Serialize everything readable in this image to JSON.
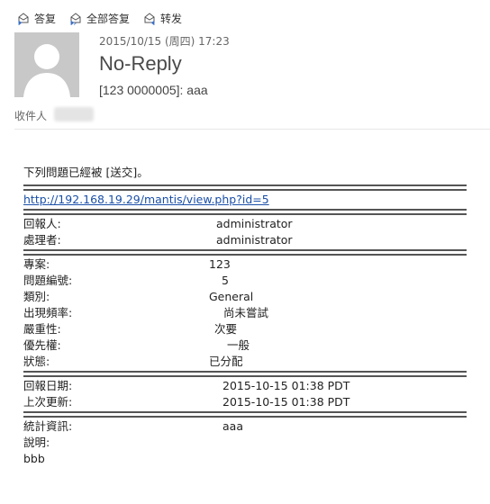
{
  "toolbar": {
    "reply": "答复",
    "reply_all": "全部答复",
    "forward": "转发"
  },
  "header": {
    "date": "2015/10/15 (周四) 17:23",
    "sender": "No-Reply",
    "subject": "[123 0000005]: aaa",
    "recipient_label": "收件人"
  },
  "body": {
    "intro": "下列問題已經被 [送交]。",
    "link": "http://192.168.19.29/mantis/view.php?id=5",
    "group1": [
      {
        "label": "回報人:",
        "value": "administrator"
      },
      {
        "label": "處理者:",
        "value": "administrator"
      }
    ],
    "group2": [
      {
        "label": "專案:",
        "value": "123"
      },
      {
        "label": "問題編號:",
        "value": "5"
      },
      {
        "label": "類別:",
        "value": "General"
      },
      {
        "label": "出現頻率:",
        "value": "尚未嘗試"
      },
      {
        "label": "嚴重性:",
        "value": "次要"
      },
      {
        "label": "優先權:",
        "value": "一般"
      },
      {
        "label": "狀態:",
        "value": "已分配"
      }
    ],
    "group3": [
      {
        "label": "回報日期:",
        "value": "2015-10-15 01:38 PDT"
      },
      {
        "label": "上次更新:",
        "value": "2015-10-15 01:38 PDT"
      }
    ],
    "group4": [
      {
        "label": "統計資訊:",
        "value": "aaa"
      },
      {
        "label": "說明:",
        "value": ""
      }
    ],
    "tail": "bbb"
  }
}
